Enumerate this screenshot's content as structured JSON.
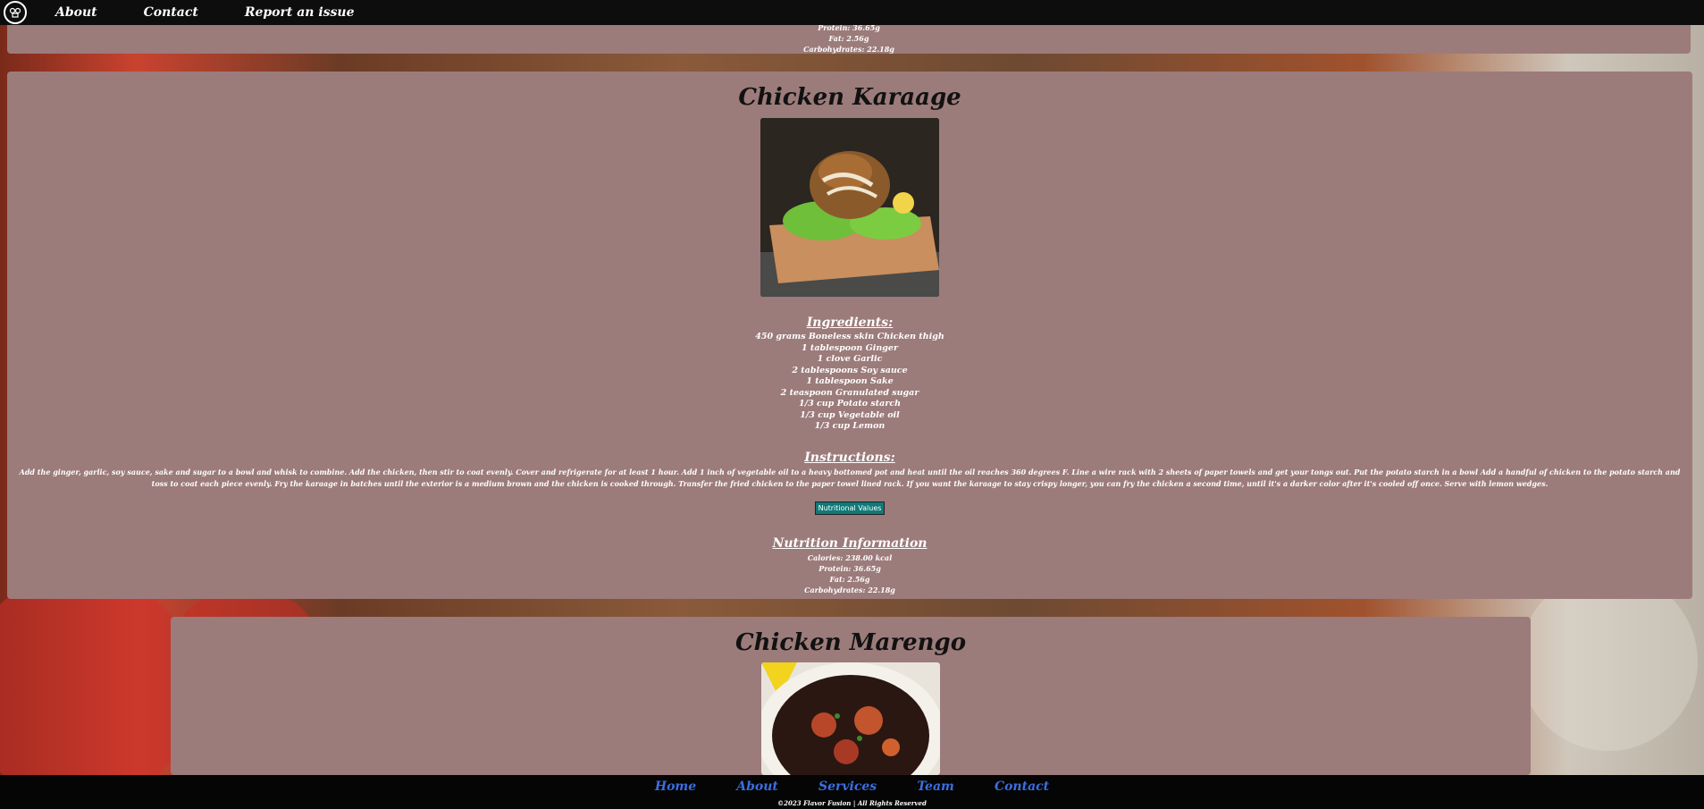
{
  "topbar": {
    "logo_icon": "chef-hat-icon",
    "links": [
      "About",
      "Contact",
      "Report an issue"
    ]
  },
  "prev_card": {
    "nutrition": [
      "Protein: 36.65g",
      "Fat: 2.56g",
      "Carbohydrates: 22.18g"
    ]
  },
  "karaage": {
    "title": "Chicken Karaage",
    "ingredients_heading": "Ingredients:",
    "ingredients": [
      "450 grams Boneless skin Chicken thigh",
      "1 tablespoon Ginger",
      "1 clove Garlic",
      "2 tablespoons Soy sauce",
      "1 tablespoon Sake",
      "2 teaspoon Granulated sugar",
      "1/3 cup Potato starch",
      "1/3 cup Vegetable oil",
      "1/3 cup Lemon"
    ],
    "instructions_heading": "Instructions:",
    "instructions": "Add the ginger, garlic, soy sauce, sake and sugar to a bowl and whisk to combine. Add the chicken, then stir to coat evenly. Cover and refrigerate for at least 1 hour. Add 1 inch of vegetable oil to a heavy bottomed pot and heat until the oil reaches 360 degrees F. Line a wire rack with 2 sheets of paper towels and get your tongs out. Put the potato starch in a bowl Add a handful of chicken to the potato starch and toss to coat each piece evenly. Fry the karaage in batches until the exterior is a medium brown and the chicken is cooked through. Transfer the fried chicken to the paper towel lined rack. If you want the karaage to stay crispy longer, you can fry the chicken a second time, until it's a darker color after it's cooled off once. Serve with lemon wedges.",
    "button_label": "Nutritional Values",
    "nutrition_heading": "Nutrition Information",
    "nutrition": [
      "Calories: 238.00 kcal",
      "Protein: 36.65g",
      "Fat: 2.56g",
      "Carbohydrates: 22.18g"
    ]
  },
  "marengo": {
    "title": "Chicken Marengo"
  },
  "footer": {
    "links": [
      "Home",
      "About",
      "Services",
      "Team",
      "Contact"
    ],
    "copyright": "©2023 Flavor Fusion | All Rights Reserved"
  }
}
